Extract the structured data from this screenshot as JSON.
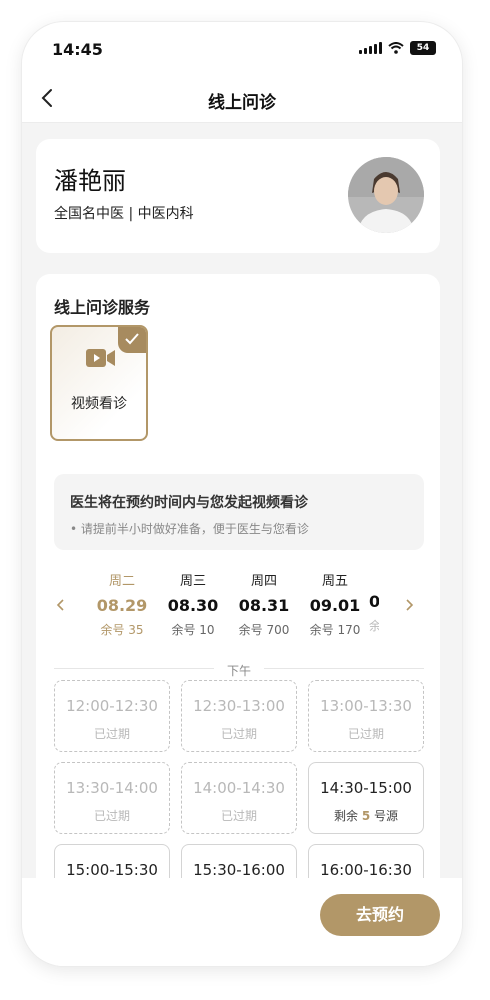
{
  "status_bar": {
    "time": "14:45",
    "battery": "54"
  },
  "header": {
    "title": "线上问诊"
  },
  "doctor": {
    "name": "潘艳丽",
    "description": "全国名中医 | 中医内科"
  },
  "services": {
    "title": "线上问诊服务",
    "options": [
      {
        "label": "视频看诊",
        "selected": true
      }
    ]
  },
  "notice": {
    "title": "医生将在预约时间内与您发起视频看诊",
    "subtitle": "• 请提前半小时做好准备，便于医生与您看诊"
  },
  "dates": [
    {
      "weekday": "周二",
      "date": "08.29",
      "remaining": "余号 35",
      "active": true
    },
    {
      "weekday": "周三",
      "date": "08.30",
      "remaining": "余号 10",
      "active": false
    },
    {
      "weekday": "周四",
      "date": "08.31",
      "remaining": "余号 700",
      "active": false
    },
    {
      "weekday": "周五",
      "date": "09.01",
      "remaining": "余号 170",
      "active": false
    },
    {
      "weekday": "",
      "date": "0",
      "remaining": "余",
      "active": false
    }
  ],
  "period_label": "下午",
  "slots": [
    {
      "range": "12:00-12:30",
      "status": "已过期",
      "expired": true
    },
    {
      "range": "12:30-13:00",
      "status": "已过期",
      "expired": true
    },
    {
      "range": "13:00-13:30",
      "status": "已过期",
      "expired": true
    },
    {
      "range": "13:30-14:00",
      "status": "已过期",
      "expired": true
    },
    {
      "range": "14:00-14:30",
      "status": "已过期",
      "expired": true
    },
    {
      "range": "14:30-15:00",
      "status_prefix": "剩余",
      "count": "5",
      "status_suffix": "号源",
      "expired": false
    },
    {
      "range": "15:00-15:30",
      "expired": false
    },
    {
      "range": "15:30-16:00",
      "expired": false
    },
    {
      "range": "16:00-16:30",
      "expired": false
    }
  ],
  "footer": {
    "book_label": "去预约"
  },
  "colors": {
    "accent": "#b29768",
    "background": "#f4f4f4",
    "expired": "#b8b8b8"
  }
}
